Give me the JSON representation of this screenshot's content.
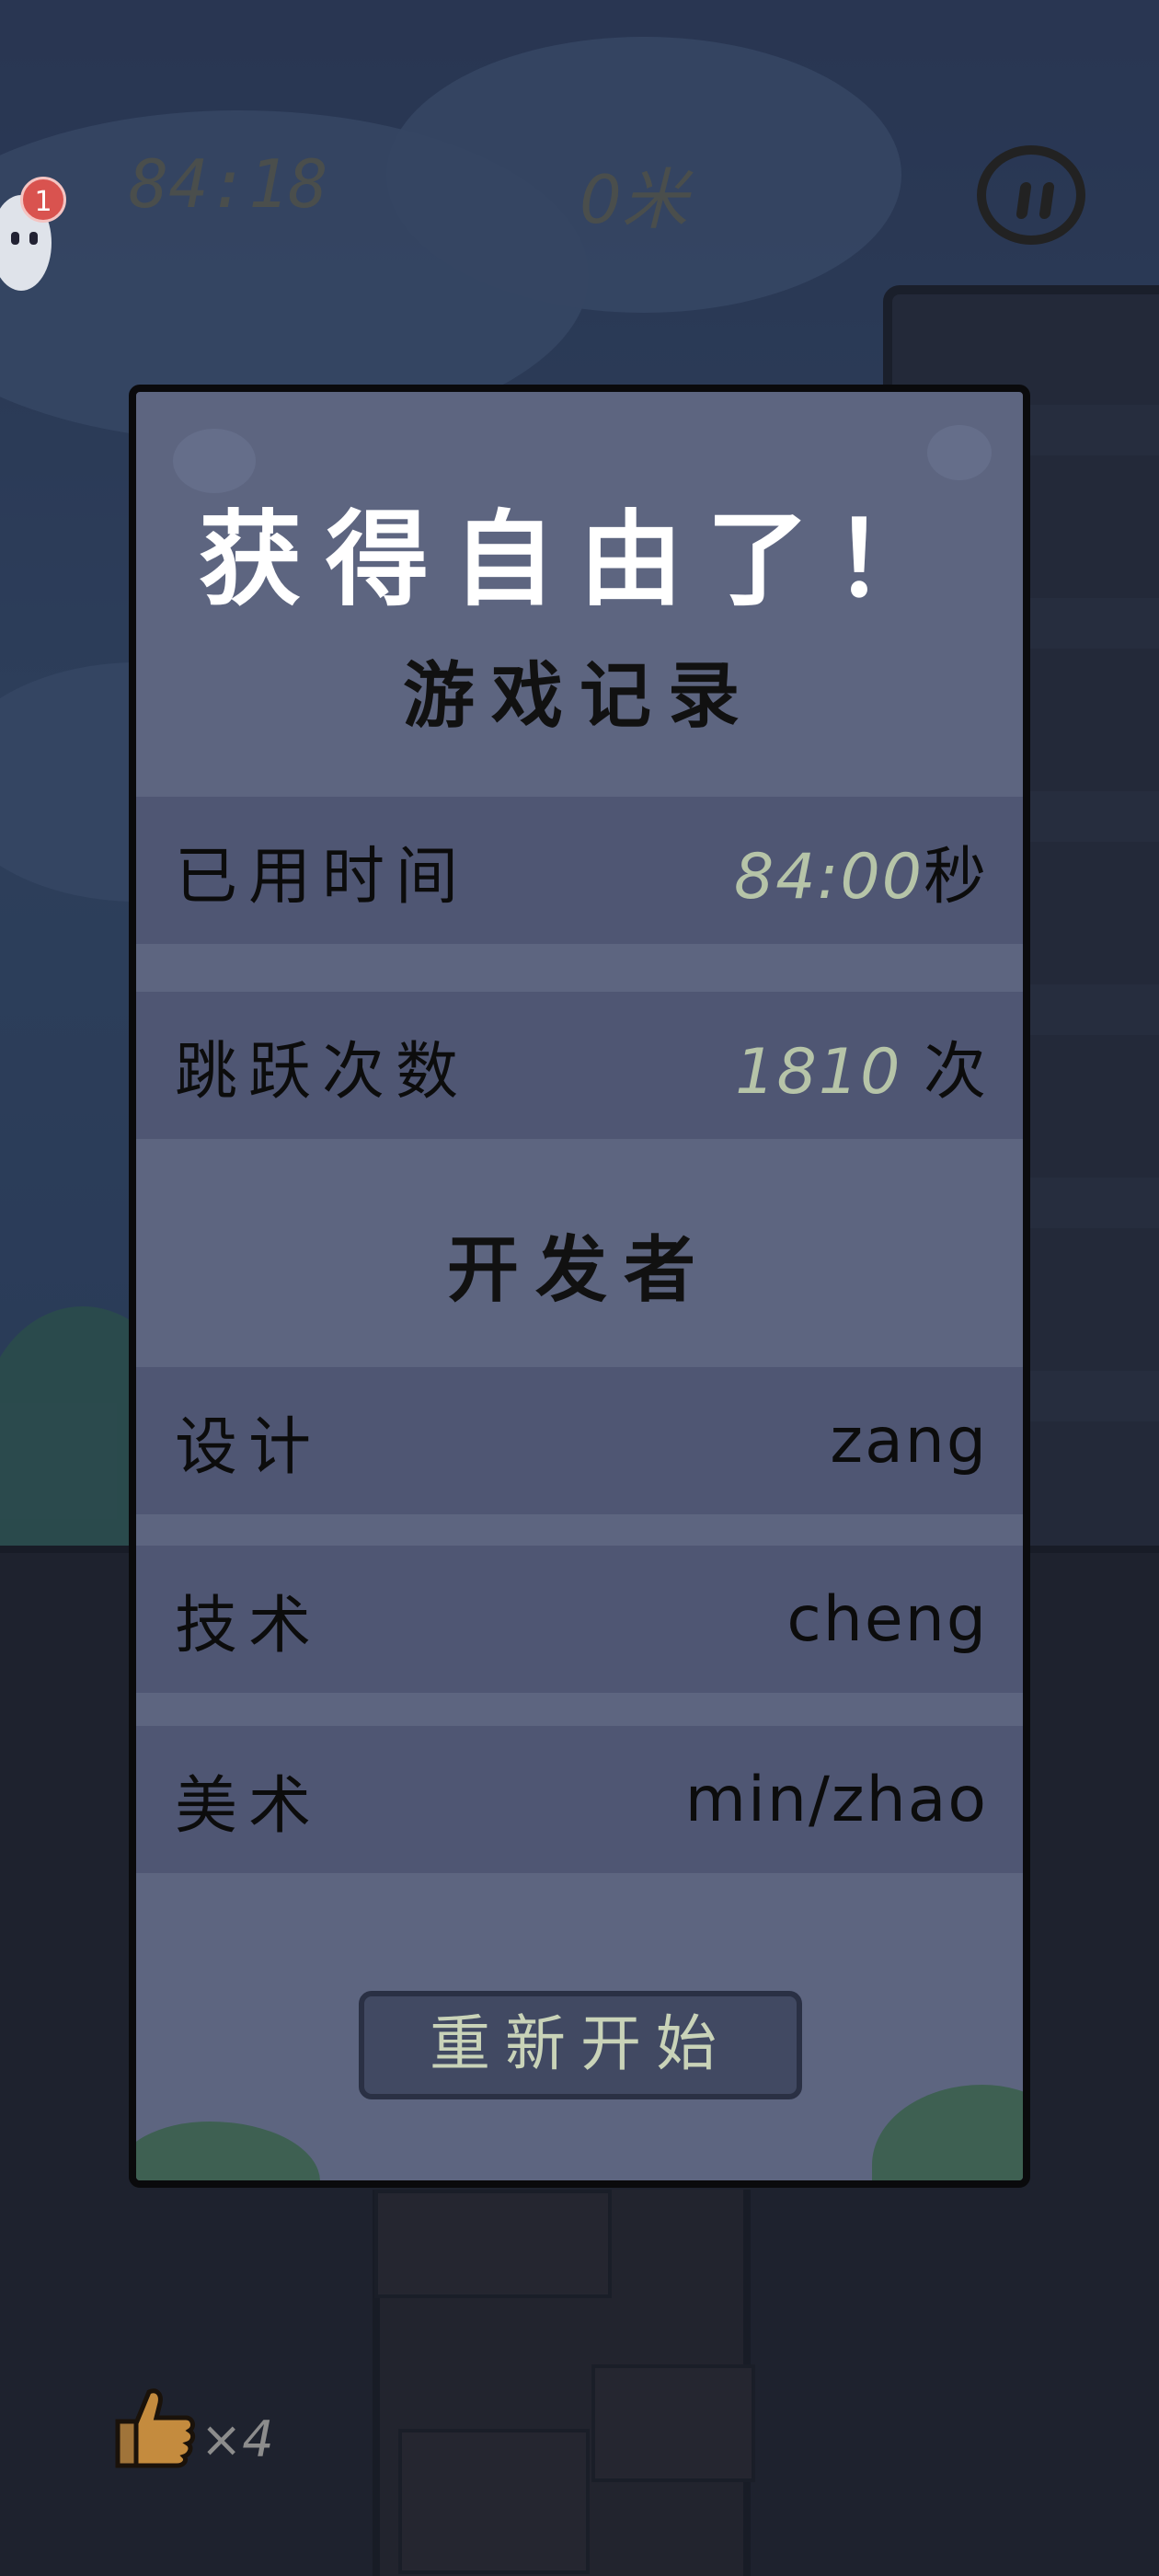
{
  "hud": {
    "timer": "84:18",
    "distance": "0米",
    "notification_count": "1",
    "item_count": "×4"
  },
  "dialog": {
    "title": "获得自由了！",
    "record_header": "游戏记录",
    "records": [
      {
        "label": "已用时间",
        "value": "84:00",
        "unit": "秒"
      },
      {
        "label": "跳跃次数",
        "value": "1810",
        "unit": "次"
      }
    ],
    "developers_header": "开发者",
    "developers": [
      {
        "role": "设计",
        "name": "zang"
      },
      {
        "role": "技术",
        "name": "cheng"
      },
      {
        "role": "美术",
        "name": "min/zhao"
      }
    ],
    "restart_label": "重新开始"
  },
  "colors": {
    "panel": "#5d6580",
    "row": "#4f5673",
    "highlight_number": "#b6c4a8",
    "button": "#414962"
  }
}
